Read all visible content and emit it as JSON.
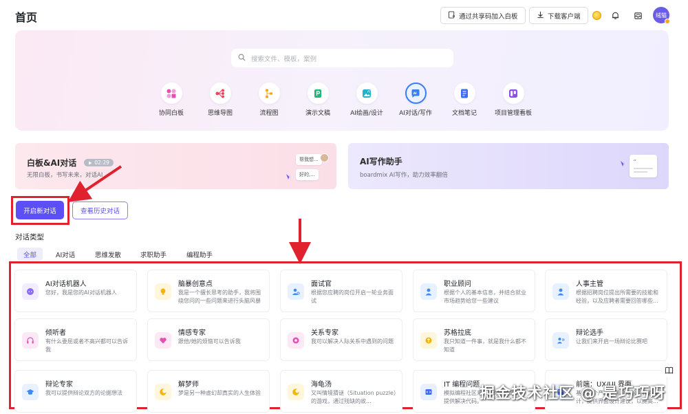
{
  "header": {
    "title": "首页",
    "join_board_label": "通过共享码加入白板",
    "download_label": "下载客户端",
    "avatar_text": "绒猫"
  },
  "search": {
    "placeholder": "搜索文件、模板，案例"
  },
  "tools": [
    {
      "label": "协同白板",
      "icon": "whiteboard-icon"
    },
    {
      "label": "思维导图",
      "icon": "mindmap-icon"
    },
    {
      "label": "流程图",
      "icon": "flowchart-icon"
    },
    {
      "label": "演示文稿",
      "icon": "presentation-icon"
    },
    {
      "label": "AI绘画/设计",
      "icon": "ai-image-icon"
    },
    {
      "label": "AI对话/写作",
      "icon": "ai-chat-icon",
      "active": true
    },
    {
      "label": "文档笔记",
      "icon": "document-icon"
    },
    {
      "label": "项目管理看板",
      "icon": "kanban-icon"
    }
  ],
  "cards": {
    "whiteboard_ai": {
      "title": "白板&AI对话",
      "duration": "02:29",
      "subtitle": "无限白板，书写未来，对话AI",
      "bubble1": "帮我想...",
      "bubble2": "好的,..."
    },
    "ai_writer": {
      "title": "AI写作助手",
      "subtitle": "boardmix AI写作，助力效率翻倍"
    }
  },
  "actions": {
    "new_chat": "开启新对话",
    "history": "查看历史对话"
  },
  "section_label": "对话类型",
  "tabs": [
    "全部",
    "AI对话",
    "思维发散",
    "求职助手",
    "编程助手"
  ],
  "bots": [
    {
      "title": "AI对话机器人",
      "desc": "您好，我是您的AI对话机器人",
      "color": "#8b6cf6",
      "bg": "#f1edff",
      "icon": "chat-bot-icon"
    },
    {
      "title": "脑暴创意点",
      "desc": "我是一个擅长思考的助手，我将围绕您问的一些问题来进行头脑风暴",
      "color": "#f5b400",
      "bg": "#fff6dc",
      "icon": "lightbulb-icon"
    },
    {
      "title": "面试官",
      "desc": "根据您应聘的岗位开启一轮业务面试",
      "color": "#3b8cf7",
      "bg": "#e8f1ff",
      "icon": "interviewer-icon"
    },
    {
      "title": "职业顾问",
      "desc": "根据个人的基本信息，并结合就业市场趋势给您一些建议",
      "color": "#3b8cf7",
      "bg": "#e8f1ff",
      "icon": "career-advisor-icon"
    },
    {
      "title": "人事主管",
      "desc": "根据招聘岗位提出所需要的技能和经验，以及应聘者需要回答哪些...",
      "color": "#3b8cf7",
      "bg": "#e8f1ff",
      "icon": "hr-manager-icon"
    },
    {
      "title": "倾听者",
      "desc": "有什么委屈或者不高兴都可以告诉我",
      "color": "#e64fb4",
      "bg": "#fde9f6",
      "icon": "headphone-icon"
    },
    {
      "title": "情感专家",
      "desc": "跟他/她的烦恼可以告诉我",
      "color": "#e64fb4",
      "bg": "#fde9f6",
      "icon": "heart-icon"
    },
    {
      "title": "关系专家",
      "desc": "我可以解决人际关系中遇到的问题",
      "color": "#e64fb4",
      "bg": "#fde9f6",
      "icon": "relationship-icon"
    },
    {
      "title": "苏格拉底",
      "desc": "我只知道一件事，就是我什么都不知道",
      "color": "#f5b400",
      "bg": "#fff6dc",
      "icon": "socrates-icon"
    },
    {
      "title": "辩论选手",
      "desc": "让我们来开启一场辩论比赛吧",
      "color": "#3b8cf7",
      "bg": "#e8f1ff",
      "icon": "debater-icon"
    },
    {
      "title": "辩论专家",
      "desc": "我可以提供辩论双方的论据想法",
      "color": "#3b8cf7",
      "bg": "#e8f1ff",
      "icon": "graduation-cap-icon"
    },
    {
      "title": "解梦师",
      "desc": "梦是另一种虚幻却真实的人生体验",
      "color": "#f5b400",
      "bg": "#fff6dc",
      "icon": "moon-icon"
    },
    {
      "title": "海龟汤",
      "desc": "又叫情境猜谜（Situation puzzle）的游戏，通过残缺的故...",
      "color": "#f5b400",
      "bg": "#fff6dc",
      "icon": "turtle-soup-icon"
    },
    {
      "title": "IT 编程问题",
      "desc": "模拟编程社区来回答你的问题，并提供解决代码。",
      "color": "#3b6cf7",
      "bg": "#e8efff",
      "icon": "code-icon"
    },
    {
      "title": "前端：UX/UI 界面",
      "desc": "基于某个产品的用户体验与界面设计，提供界面设计建议，以提高...",
      "color": "#3b6cf7",
      "bg": "#e8efff",
      "icon": "ui-design-icon"
    }
  ],
  "watermark": "掘金技术社区 @ 是巧巧呀",
  "colors": {
    "primary": "#5b4ff5",
    "annotation_red": "#e0212e"
  }
}
